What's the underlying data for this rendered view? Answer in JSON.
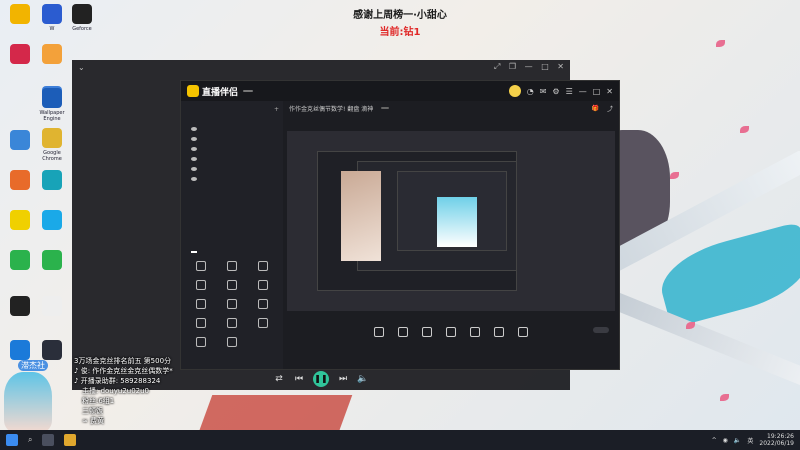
{
  "banner": {
    "line1": "感谢上周榜一·小甜心",
    "line2": "当前:钻1"
  },
  "desktop_icons": [
    {
      "label": "",
      "color": "#f2b400"
    },
    {
      "label": "W",
      "color": "#2b5cd0"
    },
    {
      "label": "Geforce",
      "color": "#222222"
    },
    {
      "label": "",
      "color": "#d4284a"
    },
    {
      "label": "",
      "color": "#f3a13a"
    },
    {
      "label": "",
      "color": "#3e7fd9"
    },
    {
      "label": "Wallpaper Engine",
      "color": "#1c5db8"
    },
    {
      "label": "",
      "color": "#3a86d8"
    },
    {
      "label": "Google Chrome",
      "color": "#e0b430"
    },
    {
      "label": "",
      "color": "#e86b2a"
    },
    {
      "label": "",
      "color": "#18a3b8"
    },
    {
      "label": "",
      "color": "#f0d000"
    },
    {
      "label": "",
      "color": "#1aa9e8"
    },
    {
      "label": "",
      "color": "#2bb24c"
    },
    {
      "label": "",
      "color": "#2bb24c"
    },
    {
      "label": "",
      "color": "#222222"
    },
    {
      "label": "",
      "color": "#eeeeee"
    },
    {
      "label": "",
      "color": "#1b7ad9"
    },
    {
      "label": "",
      "color": "#2a2e3a"
    }
  ],
  "outer_window": {
    "status": [
      "",
      ""
    ]
  },
  "app": {
    "title": "直播伴侣",
    "version": "",
    "header_text": "作作金克丝偶节数学! 翻盘 滴神",
    "header_btn": "",
    "sub_info": [
      "",
      "",
      ""
    ],
    "side_tabs": [
      {
        "label": "",
        "active": true
      },
      {
        "label": "",
        "active": false
      },
      {
        "label": "",
        "active": false
      }
    ],
    "scene_head": "",
    "scenes": [
      {
        "label": "",
        "dim": false
      },
      {
        "label": "",
        "dim": false
      },
      {
        "label": "",
        "dim": false
      },
      {
        "label": "",
        "dim": true
      },
      {
        "label": "",
        "dim": true
      },
      {
        "label": "",
        "dim": false
      }
    ],
    "tooltip": "",
    "tools": [
      "",
      "",
      "",
      "",
      "",
      "",
      "",
      "",
      "",
      "",
      "",
      "",
      "",
      ""
    ],
    "bottom_tools": [
      "",
      "",
      "",
      "",
      "",
      "",
      ""
    ],
    "start_label": "",
    "stats": [
      "",
      "",
      "",
      ""
    ]
  },
  "overlay": {
    "lines": [
      "3万场金克丝排名前五 第500分",
      "♪ 俊: 作作金克丝金克丝偶数学*",
      "♪ 开播录助群: 589288324",
      "主播: douyu2u02u0",
      "粉丝:6组1",
      "三顿饭",
      "≈ 费黄"
    ],
    "badge": "滞杰社"
  },
  "taskbar": {
    "time": "19:26:26",
    "date": "2022/06/19",
    "tray_label": "英"
  }
}
